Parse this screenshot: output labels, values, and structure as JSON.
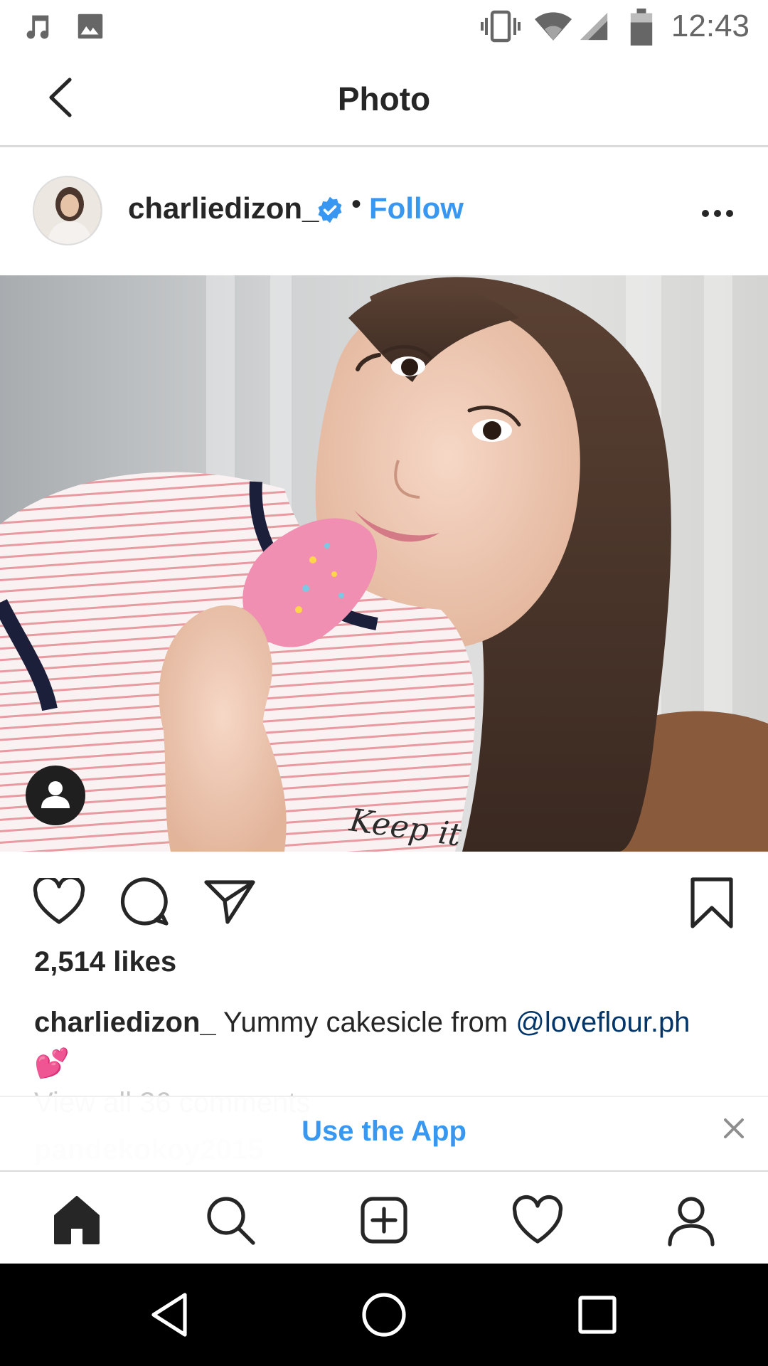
{
  "status_bar": {
    "time": "12:43"
  },
  "header": {
    "title": "Photo"
  },
  "post": {
    "username": "charliedizon_",
    "separator": "•",
    "follow_label": "Follow",
    "likes": "2,514 likes",
    "caption_user": "charliedizon_",
    "caption_text": " Yummy cakesicle from ",
    "caption_mention": "@loveflour.ph",
    "caption_emoji": "💕",
    "view_comments": "View all 36 comments",
    "comment_peek_user": "pandekokoy2015"
  },
  "banner": {
    "label": "Use the App"
  },
  "colors": {
    "accent": "#3897f0",
    "mention": "#003569",
    "text": "#262626",
    "divider": "#dbdbdb"
  },
  "icons": {
    "status_left": [
      "music-note-icon",
      "image-icon"
    ],
    "status_right": [
      "vibrate-icon",
      "wifi-icon",
      "signal-icon",
      "battery-icon"
    ],
    "actions": [
      "heart-icon",
      "comment-icon",
      "share-icon",
      "bookmark-icon"
    ],
    "bottom_nav": [
      "home-icon",
      "search-icon",
      "new-post-icon",
      "activity-heart-icon",
      "profile-icon"
    ],
    "system_nav": [
      "back-triangle-icon",
      "home-circle-icon",
      "recents-square-icon"
    ]
  }
}
